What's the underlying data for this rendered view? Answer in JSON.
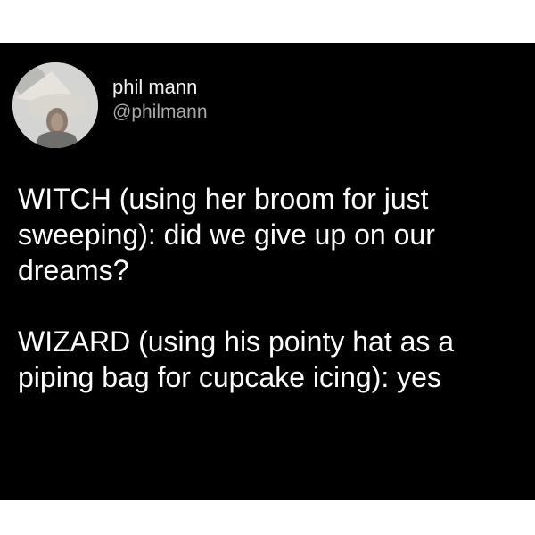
{
  "user": {
    "display_name": "phil mann",
    "handle": "@philmann"
  },
  "tweet": {
    "paragraphs": [
      "WITCH (using her broom for just sweeping): did we give up on our dreams?",
      "WIZARD (using his pointy hat as a piping bag for cupcake icing): yes"
    ]
  },
  "colors": {
    "background": "#000000",
    "text": "#ffffff",
    "handle": "#a9a9a9",
    "page": "#ffffff"
  }
}
